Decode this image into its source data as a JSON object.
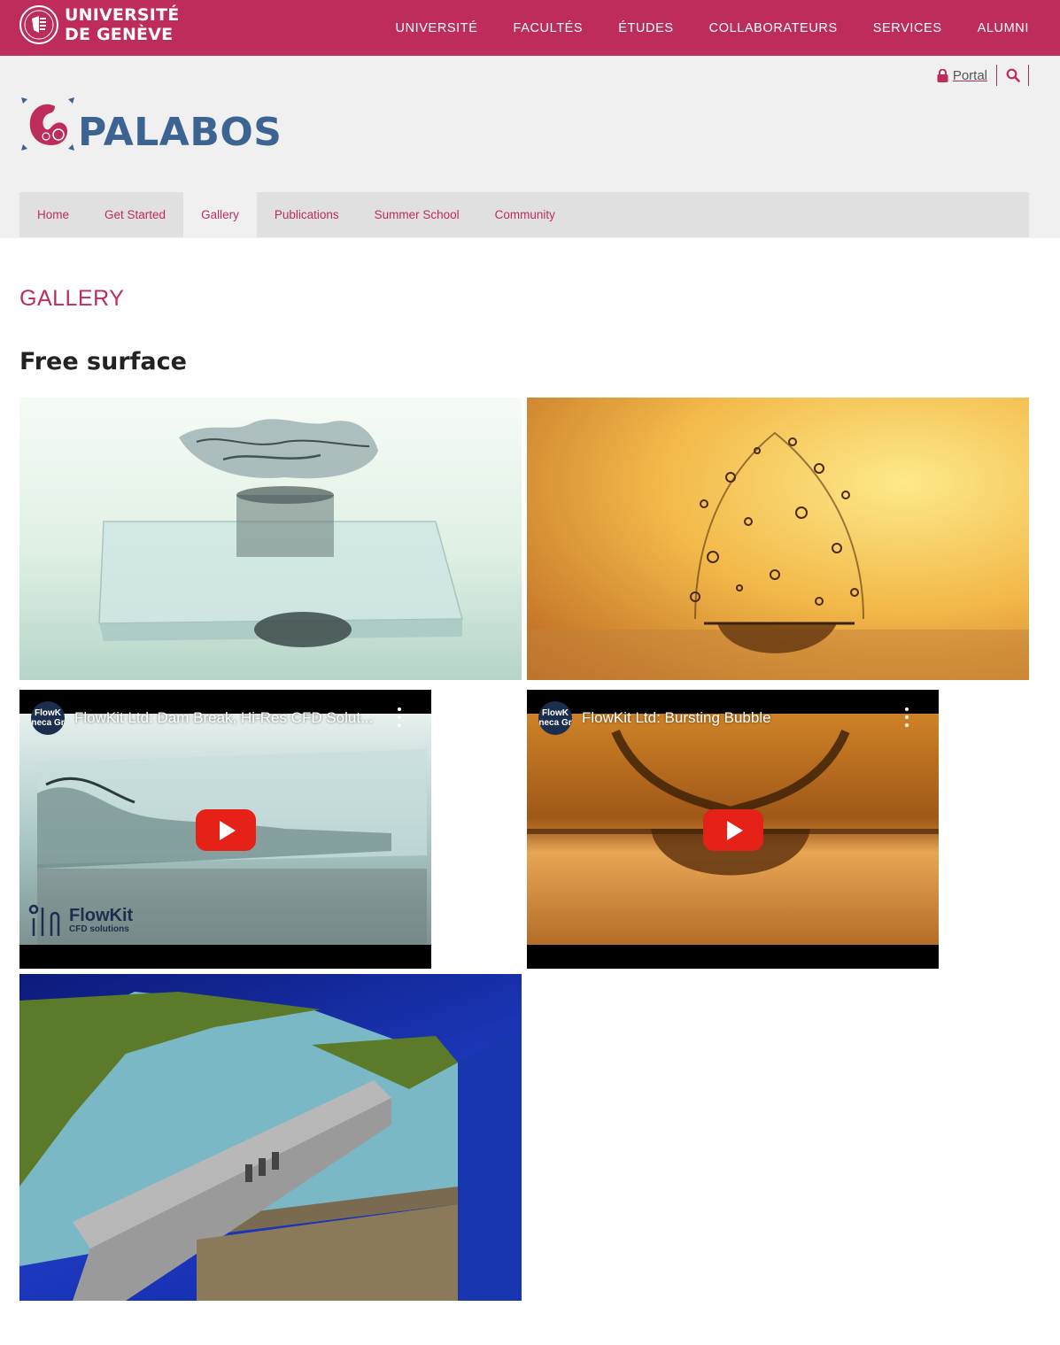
{
  "university": {
    "name_line1": "UNIVERSITÉ",
    "name_line2": "DE GENÈVE",
    "nav": [
      "UNIVERSITÉ",
      "FACULTÉS",
      "ÉTUDES",
      "COLLABORATEURS",
      "SERVICES",
      "ALUMNI"
    ]
  },
  "tools": {
    "portal_label": "Portal"
  },
  "site": {
    "name": "PALABOS"
  },
  "main_nav": [
    {
      "label": "Home",
      "active": false
    },
    {
      "label": "Get Started",
      "active": false
    },
    {
      "label": "Gallery",
      "active": true
    },
    {
      "label": "Publications",
      "active": false
    },
    {
      "label": "Summer School",
      "active": false
    },
    {
      "label": "Community",
      "active": false
    }
  ],
  "page": {
    "title": "GALLERY",
    "section": "Free surface"
  },
  "videos": [
    {
      "title": "FlowKit Ltd: Dam Break, Hi-Res CFD Solut...",
      "channel_line1": "FlowK",
      "channel_line2": "neca Gr"
    },
    {
      "title": "FlowKit Ltd: Bursting Bubble",
      "channel_line1": "FlowK",
      "channel_line2": "neca Gr"
    }
  ],
  "flowkit": {
    "name": "FlowKit",
    "sub": "CFD solutions"
  },
  "colors": {
    "brand": "#be2d5a",
    "palabos_blue": "#3d6392",
    "header_bg": "#f0f0f0",
    "nav_bg": "#e0e0e0"
  }
}
